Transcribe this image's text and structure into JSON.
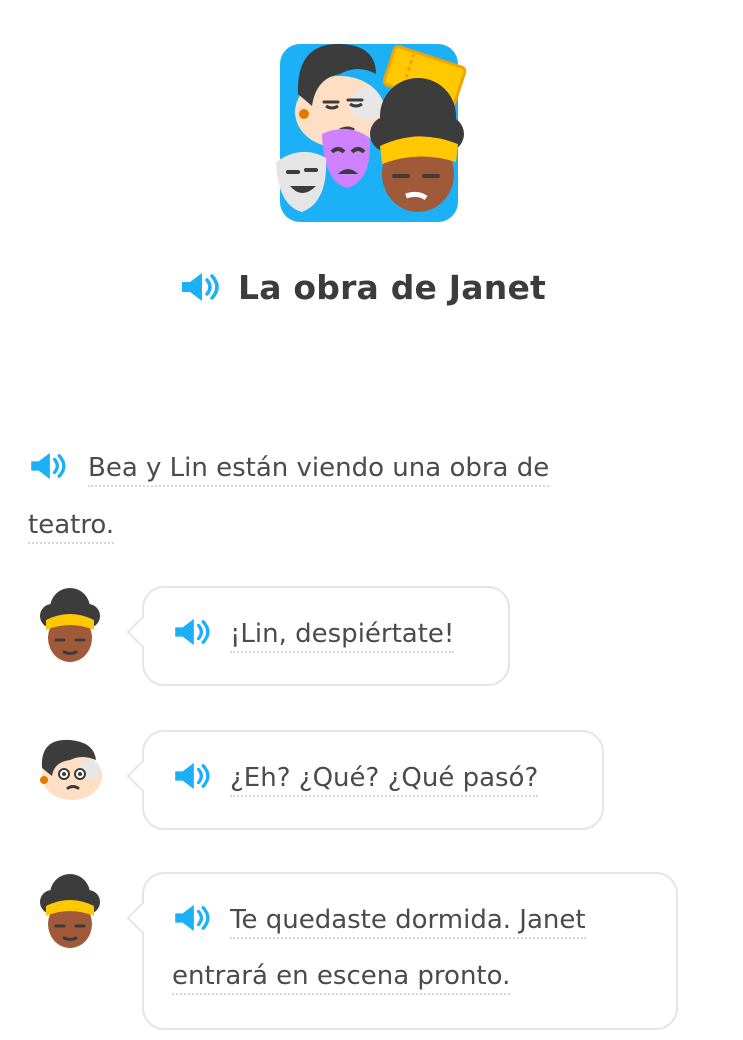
{
  "story": {
    "title": "La obra de Janet",
    "art_icon": "theater-masks-story-art",
    "accent_color": "#1cb0f6"
  },
  "narration": {
    "text_line1": "Bea y Lin están viendo una obra de",
    "text_line2": "teatro."
  },
  "dialogue": [
    {
      "speaker": "Bea",
      "avatar_icon": "bea-avatar",
      "line1": "¡Lin, despiértate!",
      "line2": ""
    },
    {
      "speaker": "Lin",
      "avatar_icon": "lin-avatar",
      "line1": "¿Eh? ¿Qué? ¿Qué pasó?",
      "line2": ""
    },
    {
      "speaker": "Bea",
      "avatar_icon": "bea-avatar",
      "line1": "Te quedaste dormida. Janet",
      "line2": "entrará en escena pronto."
    }
  ],
  "icons": {
    "audio": "speaker-icon",
    "audio_color": "#1cb0f6"
  }
}
